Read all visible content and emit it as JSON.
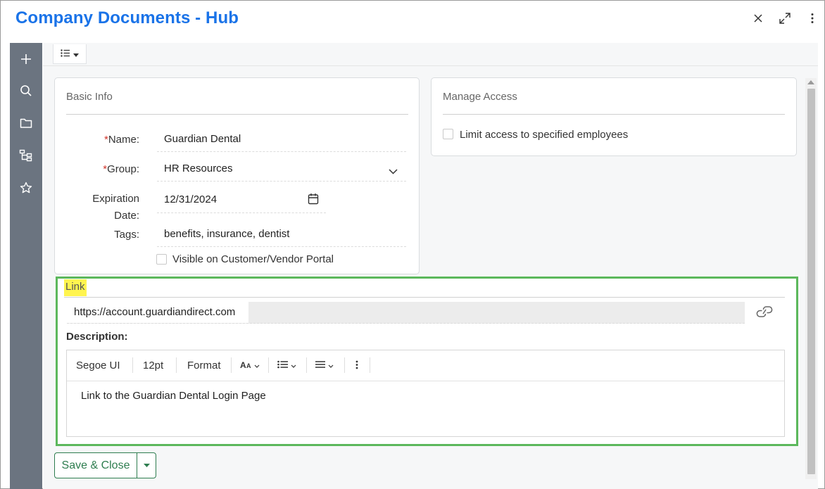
{
  "window": {
    "title": "Company Documents - Hub",
    "close_icon": "close-icon",
    "expand_icon": "expand-icon",
    "more_icon": "more-vertical-icon"
  },
  "sidebar": {
    "items": [
      {
        "icon": "plus-icon"
      },
      {
        "icon": "search-icon"
      },
      {
        "icon": "folder-icon"
      },
      {
        "icon": "hierarchy-icon"
      },
      {
        "icon": "star-icon"
      }
    ]
  },
  "topbar": {
    "view_icon": "list-view-icon"
  },
  "basic_info": {
    "title": "Basic Info",
    "name_label": "Name:",
    "name_value": "Guardian Dental",
    "group_label": "Group:",
    "group_value": "HR Resources",
    "expiration_label_line1": "Expiration",
    "expiration_label_line2": "Date:",
    "expiration_value": "12/31/2024",
    "tags_label": "Tags:",
    "tags_value": "benefits, insurance, dentist",
    "portal_label": "Visible on Customer/Vendor Portal",
    "required_mark": "*"
  },
  "manage_access": {
    "title": "Manage Access",
    "limit_label": "Limit access to specified employees"
  },
  "link_section": {
    "title": "Link",
    "url_value": "https://account.guardiandirect.com",
    "description_label": "Description:",
    "editor_toolbar": {
      "font": "Segoe UI",
      "size": "12pt",
      "format": "Format"
    },
    "description_text": "Link to the Guardian Dental Login Page"
  },
  "footer": {
    "save_label": "Save & Close"
  },
  "colors": {
    "title_blue": "#1a73e8",
    "highlight_green": "#5cb85c",
    "save_green": "#2e7d4f",
    "link_highlight": "#fff44f"
  }
}
